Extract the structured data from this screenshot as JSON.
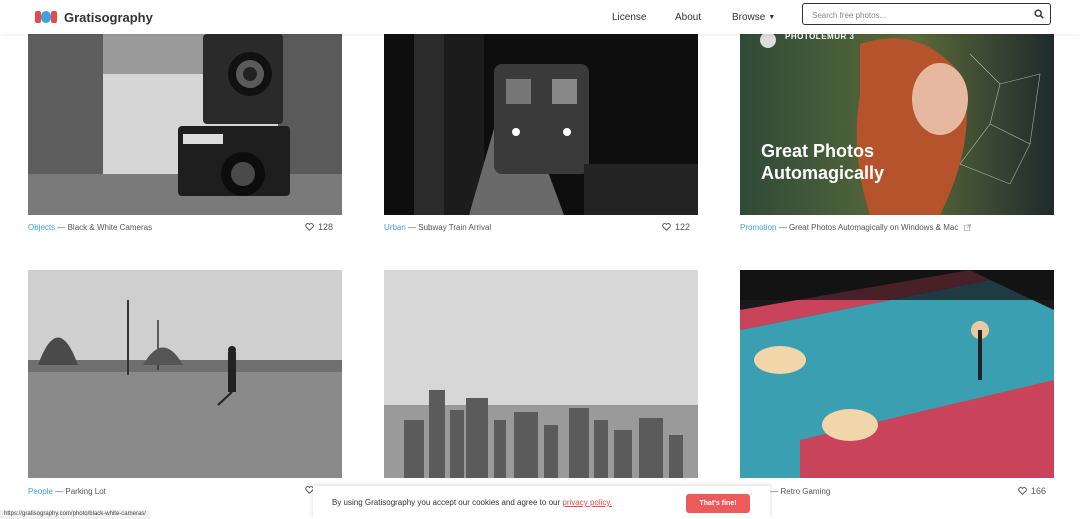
{
  "header": {
    "brand": "Gratisography",
    "nav": {
      "license": "License",
      "about": "About",
      "browse": "Browse"
    },
    "search_placeholder": "Search free photos..."
  },
  "cards": [
    {
      "category": "Objects",
      "title": "Black & White Cameras",
      "likes": "128"
    },
    {
      "category": "Urban",
      "title": "Subway Train Arrival",
      "likes": "122"
    },
    {
      "category": "Promotion",
      "title": "Great Photos Automagically on Windows & Mac",
      "promo_headline_1": "Great Photos",
      "promo_headline_2": "Automagically",
      "promo_brand": "PHOTOLEMUR 3"
    },
    {
      "category": "People",
      "title": "Parking Lot",
      "likes": ""
    },
    {
      "category": "",
      "title": "",
      "likes": ""
    },
    {
      "category": "s",
      "title": "Retro Gaming",
      "likes": "166"
    }
  ],
  "separator": "—",
  "cookie": {
    "text": "By using Gratisography you accept our cookies and agree to our",
    "link": "privacy policy.",
    "button": "That's fine!"
  },
  "status_url": "https://gratisography.com/photo/black-white-cameras/",
  "colors": {
    "accent": "#3ba2e0",
    "brand_red": "#e84a4a",
    "button": "#ec5b5b"
  }
}
